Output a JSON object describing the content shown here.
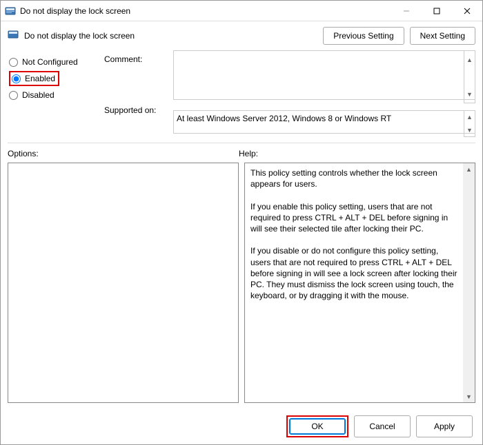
{
  "window": {
    "title": "Do not display the lock screen"
  },
  "subheader": {
    "title": "Do not display the lock screen",
    "prev": "Previous Setting",
    "next": "Next Setting"
  },
  "radios": {
    "not_configured": "Not Configured",
    "enabled": "Enabled",
    "disabled": "Disabled",
    "selected": "enabled"
  },
  "labels": {
    "comment": "Comment:",
    "supported": "Supported on:",
    "options": "Options:",
    "help": "Help:"
  },
  "fields": {
    "comment": "",
    "supported": "At least Windows Server 2012, Windows 8 or Windows RT"
  },
  "help_text": "This policy setting controls whether the lock screen appears for users.\n\nIf you enable this policy setting, users that are not required to press CTRL + ALT + DEL before signing in will see their selected tile after locking their PC.\n\nIf you disable or do not configure this policy setting, users that are not required to press CTRL + ALT + DEL before signing in will see a lock screen after locking their PC. They must dismiss the lock screen using touch, the keyboard, or by dragging it with the mouse.",
  "footer": {
    "ok": "OK",
    "cancel": "Cancel",
    "apply": "Apply"
  }
}
